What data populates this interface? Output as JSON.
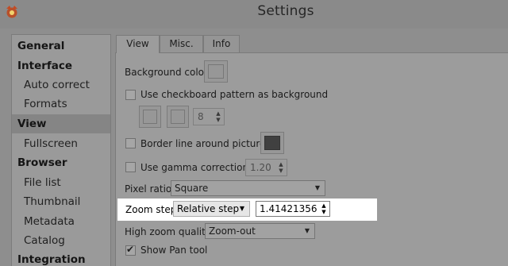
{
  "window": {
    "title": "Settings"
  },
  "sidebar": {
    "items": [
      {
        "label": "General",
        "kind": "category"
      },
      {
        "label": "Interface",
        "kind": "category"
      },
      {
        "label": "Auto correct",
        "kind": "sub"
      },
      {
        "label": "Formats",
        "kind": "sub"
      },
      {
        "label": "View",
        "kind": "category",
        "selected": true
      },
      {
        "label": "Fullscreen",
        "kind": "sub"
      },
      {
        "label": "Browser",
        "kind": "category"
      },
      {
        "label": "File list",
        "kind": "sub"
      },
      {
        "label": "Thumbnail",
        "kind": "sub"
      },
      {
        "label": "Metadata",
        "kind": "sub"
      },
      {
        "label": "Catalog",
        "kind": "sub"
      },
      {
        "label": "Integration",
        "kind": "category"
      }
    ]
  },
  "tabs": [
    {
      "label": "View",
      "active": true
    },
    {
      "label": "Misc."
    },
    {
      "label": "Info"
    }
  ],
  "view": {
    "background_color_label": "Background color",
    "checkerboard_label": "Use checkboard pattern as background",
    "checkerboard_checked": false,
    "checker_size_value": "8",
    "border_line_label": "Border line around picture",
    "border_line_checked": false,
    "border_color": "#404040",
    "gamma_label": "Use gamma correction",
    "gamma_checked": false,
    "gamma_value": "1.20",
    "pixel_ratio_label": "Pixel ratio",
    "pixel_ratio_value": "Square",
    "zoom_step_label": "Zoom step",
    "zoom_step_mode": "Relative step",
    "zoom_step_value": "1.41421356",
    "high_zoom_label": "High zoom quality",
    "high_zoom_value": "Zoom-out",
    "show_pan_label": "Show Pan tool",
    "show_pan_checked": true
  },
  "icons": {
    "app": "app-logo-icon",
    "dropdown": "chevron-down-icon",
    "spin": "spin-arrows-icon"
  }
}
